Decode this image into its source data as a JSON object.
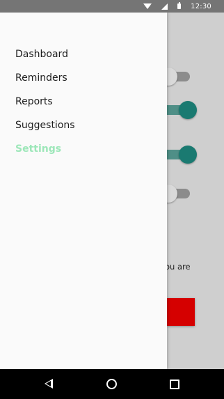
{
  "status_bar": {
    "time": "12:30"
  },
  "drawer": {
    "items": [
      {
        "label": "Dashboard",
        "active": false
      },
      {
        "label": "Reminders",
        "active": false
      },
      {
        "label": "Reports",
        "active": false
      },
      {
        "label": "Suggestions",
        "active": false
      },
      {
        "label": "Settings",
        "active": true
      }
    ]
  },
  "background": {
    "switches": [
      {
        "on": false
      },
      {
        "on": true
      },
      {
        "on": true
      },
      {
        "on": false
      }
    ],
    "partial_text": "ou are"
  },
  "colors": {
    "accent_teal": "#1a7a71",
    "active_menu": "#9de7b9",
    "danger_red": "#d50000"
  }
}
